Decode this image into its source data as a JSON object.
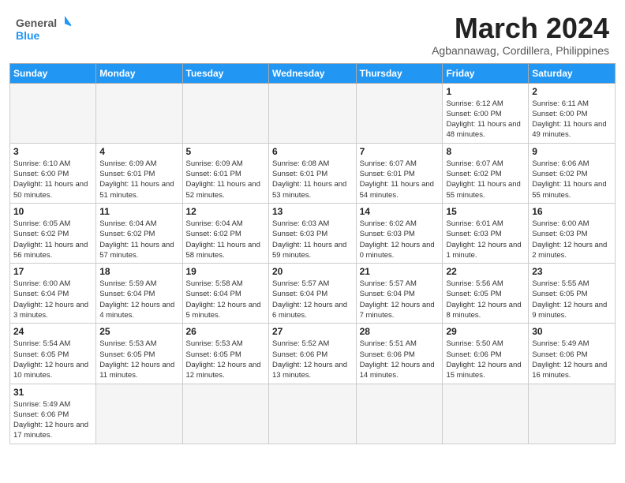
{
  "header": {
    "logo_general": "General",
    "logo_blue": "Blue",
    "month_title": "March 2024",
    "location": "Agbannawag, Cordillera, Philippines"
  },
  "days_of_week": [
    "Sunday",
    "Monday",
    "Tuesday",
    "Wednesday",
    "Thursday",
    "Friday",
    "Saturday"
  ],
  "weeks": [
    [
      {
        "num": "",
        "info": ""
      },
      {
        "num": "",
        "info": ""
      },
      {
        "num": "",
        "info": ""
      },
      {
        "num": "",
        "info": ""
      },
      {
        "num": "",
        "info": ""
      },
      {
        "num": "1",
        "info": "Sunrise: 6:12 AM\nSunset: 6:00 PM\nDaylight: 11 hours and 48 minutes."
      },
      {
        "num": "2",
        "info": "Sunrise: 6:11 AM\nSunset: 6:00 PM\nDaylight: 11 hours and 49 minutes."
      }
    ],
    [
      {
        "num": "3",
        "info": "Sunrise: 6:10 AM\nSunset: 6:00 PM\nDaylight: 11 hours and 50 minutes."
      },
      {
        "num": "4",
        "info": "Sunrise: 6:09 AM\nSunset: 6:01 PM\nDaylight: 11 hours and 51 minutes."
      },
      {
        "num": "5",
        "info": "Sunrise: 6:09 AM\nSunset: 6:01 PM\nDaylight: 11 hours and 52 minutes."
      },
      {
        "num": "6",
        "info": "Sunrise: 6:08 AM\nSunset: 6:01 PM\nDaylight: 11 hours and 53 minutes."
      },
      {
        "num": "7",
        "info": "Sunrise: 6:07 AM\nSunset: 6:01 PM\nDaylight: 11 hours and 54 minutes."
      },
      {
        "num": "8",
        "info": "Sunrise: 6:07 AM\nSunset: 6:02 PM\nDaylight: 11 hours and 55 minutes."
      },
      {
        "num": "9",
        "info": "Sunrise: 6:06 AM\nSunset: 6:02 PM\nDaylight: 11 hours and 55 minutes."
      }
    ],
    [
      {
        "num": "10",
        "info": "Sunrise: 6:05 AM\nSunset: 6:02 PM\nDaylight: 11 hours and 56 minutes."
      },
      {
        "num": "11",
        "info": "Sunrise: 6:04 AM\nSunset: 6:02 PM\nDaylight: 11 hours and 57 minutes."
      },
      {
        "num": "12",
        "info": "Sunrise: 6:04 AM\nSunset: 6:02 PM\nDaylight: 11 hours and 58 minutes."
      },
      {
        "num": "13",
        "info": "Sunrise: 6:03 AM\nSunset: 6:03 PM\nDaylight: 11 hours and 59 minutes."
      },
      {
        "num": "14",
        "info": "Sunrise: 6:02 AM\nSunset: 6:03 PM\nDaylight: 12 hours and 0 minutes."
      },
      {
        "num": "15",
        "info": "Sunrise: 6:01 AM\nSunset: 6:03 PM\nDaylight: 12 hours and 1 minute."
      },
      {
        "num": "16",
        "info": "Sunrise: 6:00 AM\nSunset: 6:03 PM\nDaylight: 12 hours and 2 minutes."
      }
    ],
    [
      {
        "num": "17",
        "info": "Sunrise: 6:00 AM\nSunset: 6:04 PM\nDaylight: 12 hours and 3 minutes."
      },
      {
        "num": "18",
        "info": "Sunrise: 5:59 AM\nSunset: 6:04 PM\nDaylight: 12 hours and 4 minutes."
      },
      {
        "num": "19",
        "info": "Sunrise: 5:58 AM\nSunset: 6:04 PM\nDaylight: 12 hours and 5 minutes."
      },
      {
        "num": "20",
        "info": "Sunrise: 5:57 AM\nSunset: 6:04 PM\nDaylight: 12 hours and 6 minutes."
      },
      {
        "num": "21",
        "info": "Sunrise: 5:57 AM\nSunset: 6:04 PM\nDaylight: 12 hours and 7 minutes."
      },
      {
        "num": "22",
        "info": "Sunrise: 5:56 AM\nSunset: 6:05 PM\nDaylight: 12 hours and 8 minutes."
      },
      {
        "num": "23",
        "info": "Sunrise: 5:55 AM\nSunset: 6:05 PM\nDaylight: 12 hours and 9 minutes."
      }
    ],
    [
      {
        "num": "24",
        "info": "Sunrise: 5:54 AM\nSunset: 6:05 PM\nDaylight: 12 hours and 10 minutes."
      },
      {
        "num": "25",
        "info": "Sunrise: 5:53 AM\nSunset: 6:05 PM\nDaylight: 12 hours and 11 minutes."
      },
      {
        "num": "26",
        "info": "Sunrise: 5:53 AM\nSunset: 6:05 PM\nDaylight: 12 hours and 12 minutes."
      },
      {
        "num": "27",
        "info": "Sunrise: 5:52 AM\nSunset: 6:06 PM\nDaylight: 12 hours and 13 minutes."
      },
      {
        "num": "28",
        "info": "Sunrise: 5:51 AM\nSunset: 6:06 PM\nDaylight: 12 hours and 14 minutes."
      },
      {
        "num": "29",
        "info": "Sunrise: 5:50 AM\nSunset: 6:06 PM\nDaylight: 12 hours and 15 minutes."
      },
      {
        "num": "30",
        "info": "Sunrise: 5:49 AM\nSunset: 6:06 PM\nDaylight: 12 hours and 16 minutes."
      }
    ],
    [
      {
        "num": "31",
        "info": "Sunrise: 5:49 AM\nSunset: 6:06 PM\nDaylight: 12 hours and 17 minutes."
      },
      {
        "num": "",
        "info": ""
      },
      {
        "num": "",
        "info": ""
      },
      {
        "num": "",
        "info": ""
      },
      {
        "num": "",
        "info": ""
      },
      {
        "num": "",
        "info": ""
      },
      {
        "num": "",
        "info": ""
      }
    ]
  ]
}
